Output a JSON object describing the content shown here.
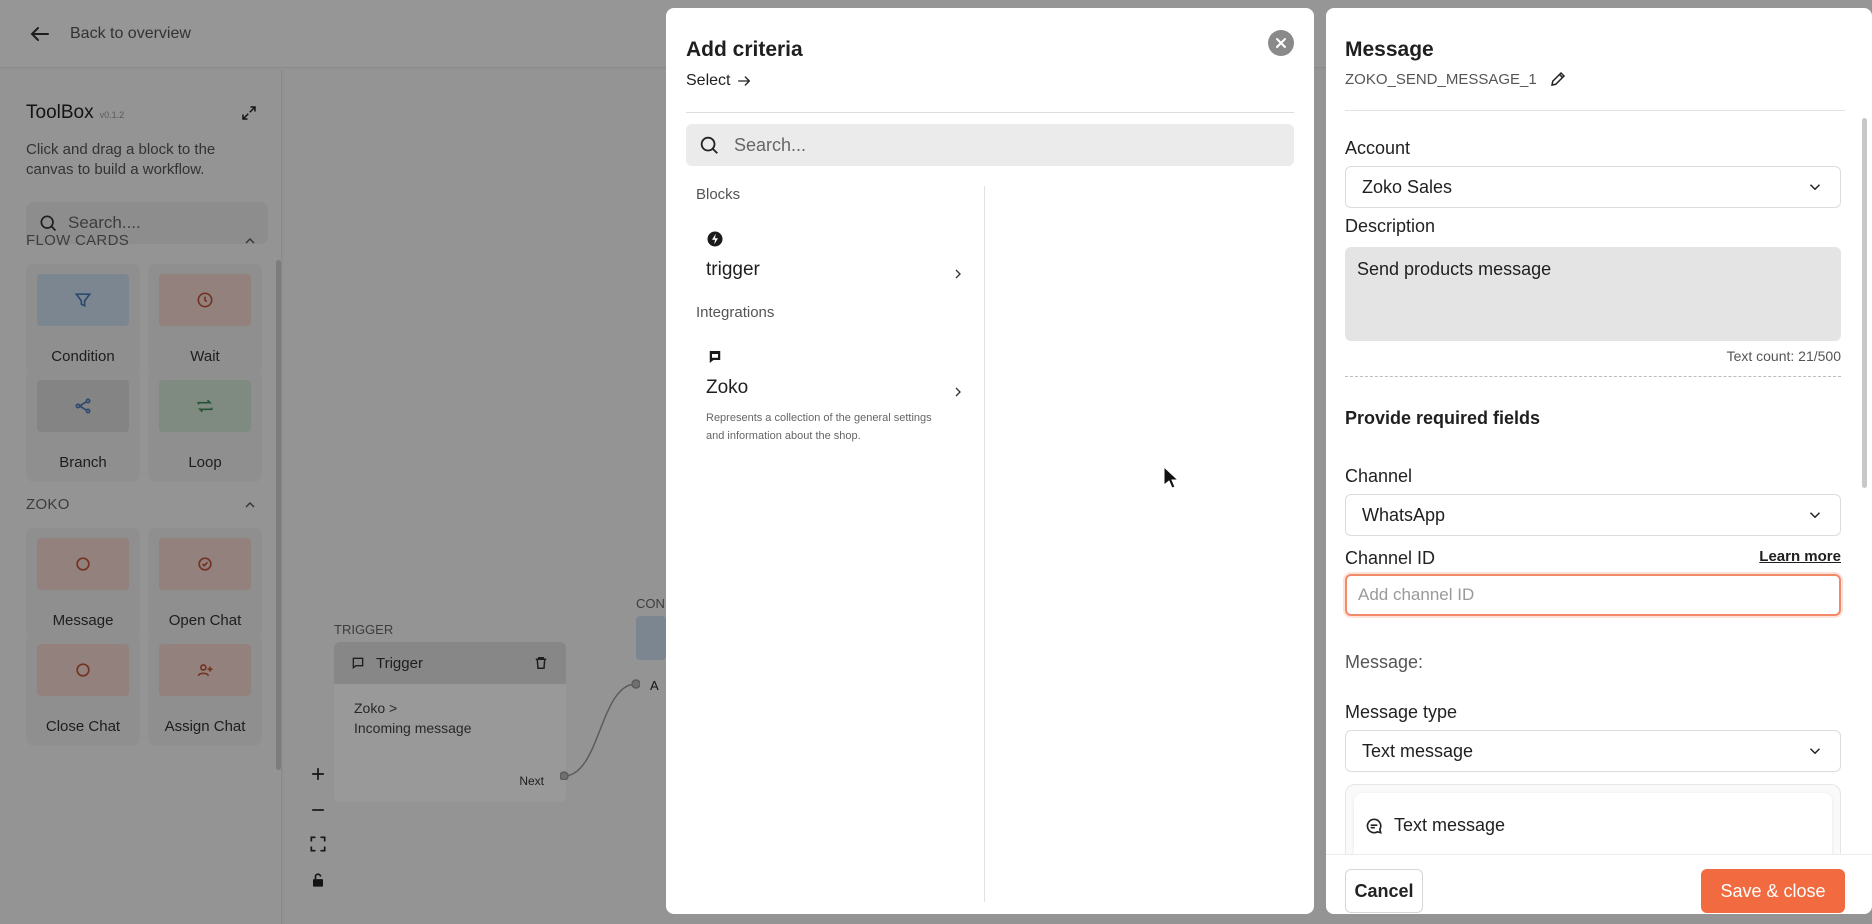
{
  "background": {
    "back_label": "Back to overview",
    "toolbox": {
      "title": "ToolBox",
      "version": "v0.1.2",
      "description": "Click and drag a block to the canvas to build a workflow.",
      "search_placeholder": "Search....",
      "sections": [
        {
          "title": "FLOW CARDS",
          "items": [
            "Condition",
            "Wait",
            "Branch",
            "Loop"
          ]
        },
        {
          "title": "ZOKO",
          "items": [
            "Message",
            "Open Chat",
            "Close Chat",
            "Assign Chat"
          ]
        }
      ]
    },
    "canvas": {
      "trigger_label": "TRIGGER",
      "trigger_node_title": "Trigger",
      "trigger_source": "Zoko >",
      "trigger_event": "Incoming message",
      "next_label": "Next",
      "condition_label_partial": "CON",
      "connector_label_partial": "A"
    }
  },
  "modal": {
    "title": "Add criteria",
    "select_label": "Select",
    "search_placeholder": "Search...",
    "groups": [
      {
        "label": "Blocks",
        "items": [
          {
            "name": "trigger",
            "icon": "bolt-icon",
            "description": ""
          }
        ]
      },
      {
        "label": "Integrations",
        "items": [
          {
            "name": "Zoko",
            "icon": "chat-icon",
            "description": "Represents a collection of the general settings and information about the shop."
          }
        ]
      }
    ]
  },
  "panel": {
    "title": "Message",
    "block_id": "ZOKO_SEND_MESSAGE_1",
    "account_label": "Account",
    "account_value": "Zoko Sales",
    "description_label": "Description",
    "description_value": "Send products message",
    "text_count": "Text count: 21/500",
    "required_title": "Provide required fields",
    "channel_label": "Channel",
    "channel_value": "WhatsApp",
    "channel_id_label": "Channel ID",
    "learn_more": "Learn more",
    "channel_id_placeholder": "Add channel ID",
    "message_label": "Message:",
    "message_type_label": "Message type",
    "message_type_value": "Text message",
    "message_card_label": "Text message",
    "cancel_label": "Cancel",
    "save_label": "Save & close"
  },
  "colors": {
    "accent": "#f26a3f",
    "focus_border": "#f28a6a",
    "overlay": "rgba(0,0,0,0.40)"
  }
}
